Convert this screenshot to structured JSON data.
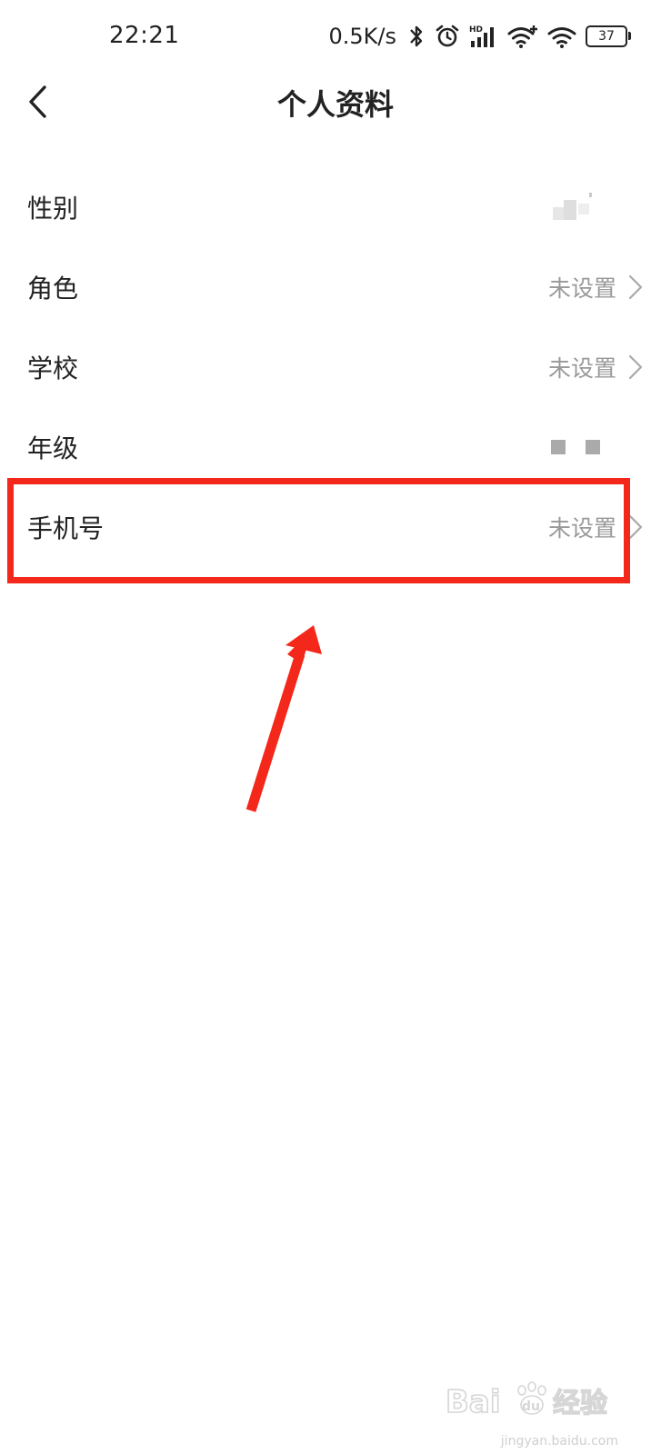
{
  "status_bar": {
    "time": "22:21",
    "net_speed": "0.5K/s",
    "battery": "37",
    "icons": [
      "bluetooth-icon",
      "alarm-icon",
      "hd-signal-icon",
      "wifi-plus-icon",
      "wifi-icon",
      "battery-icon"
    ]
  },
  "header": {
    "title": "个人资料",
    "back_icon": "chevron-left-icon"
  },
  "profile": {
    "rows": [
      {
        "label": "性别",
        "value": ""
      },
      {
        "label": "角色",
        "value": "未设置"
      },
      {
        "label": "学校",
        "value": "未设置"
      },
      {
        "label": "年级",
        "value": ""
      },
      {
        "label": "手机号",
        "value": "未设置"
      }
    ]
  },
  "annotation": {
    "highlight_color": "#f4271b"
  },
  "watermark": {
    "text": "Bai du 经验",
    "subtext": "jingyan.baidu.com"
  }
}
